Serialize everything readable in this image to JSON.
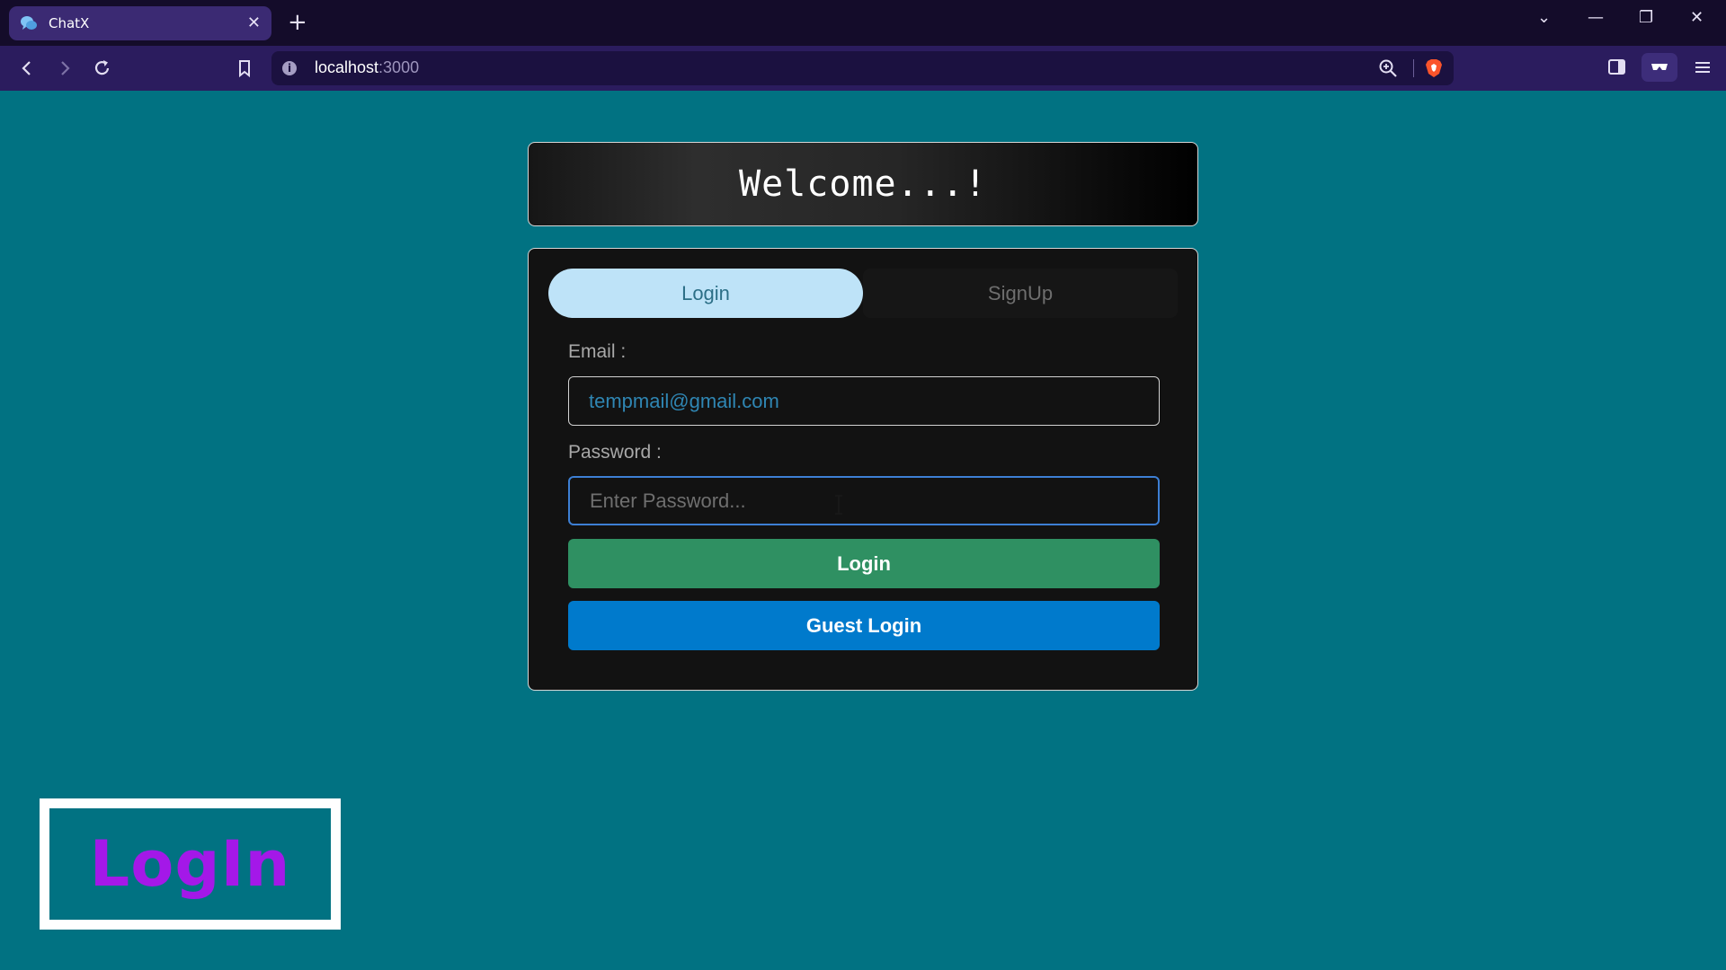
{
  "browser": {
    "tab_title": "ChatX",
    "tab_close": "✕",
    "new_tab": "+",
    "url_host": "localhost",
    "url_port": ":3000",
    "controls": {
      "dropdown": "⌄",
      "minimize": "—",
      "restore": "❐",
      "close": "✕"
    },
    "colors": {
      "tabbar": "#140c2a",
      "toolbar": "#2b1c5e",
      "active_tab": "#3b2a73"
    }
  },
  "page": {
    "welcome": "Welcome...!",
    "tabs": {
      "login": "Login",
      "signup": "SignUp",
      "active": "login"
    },
    "email_label": "Email :",
    "email_value": "tempmail@gmail.com",
    "password_label": "Password :",
    "password_placeholder": "Enter Password...",
    "login_button": "Login",
    "guest_button": "Guest Login",
    "colors": {
      "background": "#017282",
      "login_button": "#2f9062",
      "guest_button": "#007acc",
      "active_tab": "#bee3f8"
    }
  },
  "overlay": {
    "caption": "LogIn",
    "color": "#a418e8"
  }
}
